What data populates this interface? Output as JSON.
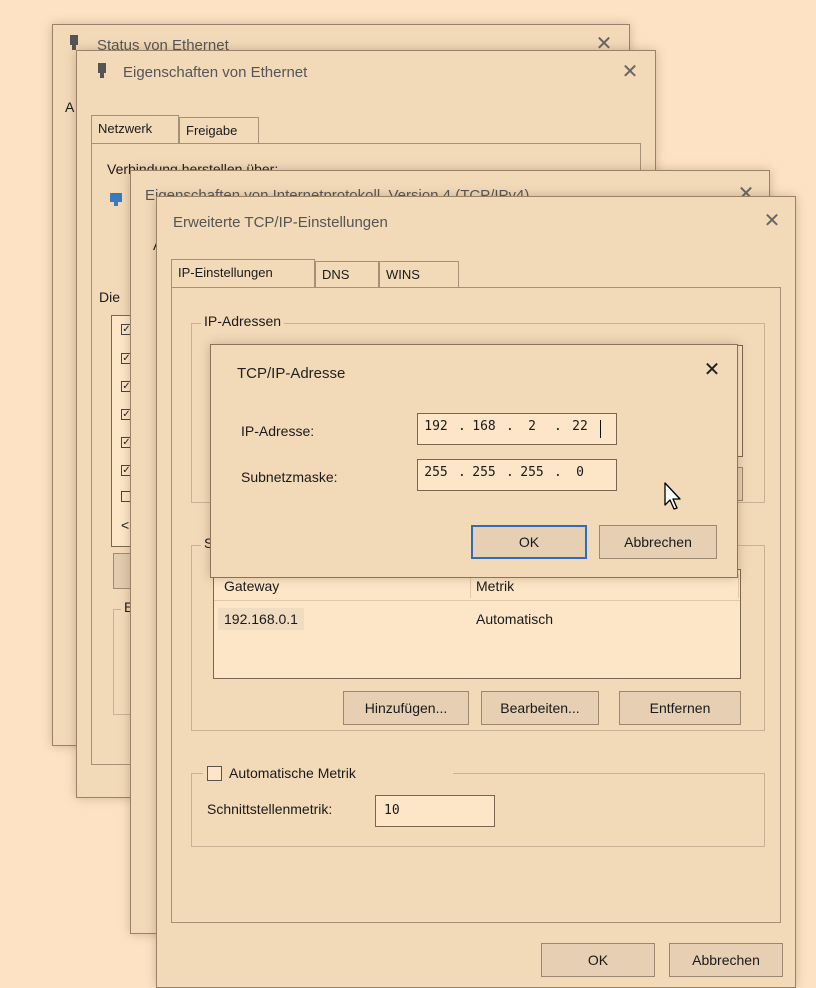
{
  "status_window": {
    "title": "Status von Ethernet",
    "partial_label": "A"
  },
  "ethernet_props_window": {
    "title": "Eigenschaften von Ethernet",
    "tabs": [
      "Netzwerk",
      "Freigabe"
    ],
    "connect_label": "Verbindung herstellen über:",
    "components_label": "Die",
    "scroll_left": "<",
    "partial_group_label": "E"
  },
  "ipv4_window": {
    "title": "Eigenschaften von Internetprotokoll, Version 4 (TCP/IPv4)",
    "partial_label": "A"
  },
  "advanced_window": {
    "title": "Erweiterte TCP/IP-Einstellungen",
    "tabs": [
      "IP-Einstellungen",
      "DNS",
      "WINS"
    ],
    "ip_group_label": "IP-Adressen",
    "gateway_group_label": "Sta",
    "gateway_table": {
      "headers": [
        "Gateway",
        "Metrik"
      ],
      "rows": [
        [
          "192.168.0.1",
          "Automatisch"
        ]
      ]
    },
    "buttons": {
      "add": "Hinzufügen...",
      "edit": "Bearbeiten...",
      "remove": "Entfernen"
    },
    "auto_metric_label": "Automatische Metrik",
    "auto_metric_checked": false,
    "interface_metric_label": "Schnittstellenmetrik:",
    "interface_metric_value": "10",
    "ok": "OK",
    "cancel": "Abbrechen"
  },
  "tcpip_dialog": {
    "title": "TCP/IP-Adresse",
    "ip_label": "IP-Adresse:",
    "ip_octets": [
      "192",
      "168",
      "2",
      "22"
    ],
    "mask_label": "Subnetzmaske:",
    "mask_octets": [
      "255",
      "255",
      "255",
      "0"
    ],
    "ok": "OK",
    "cancel": "Abbrechen"
  },
  "icons": {
    "close": "close-icon",
    "network": "network-adapter-icon",
    "cursor": "mouse-pointer-icon"
  },
  "colors": {
    "background": "#fde3c4",
    "window": "#f2d9b8",
    "accent": "#2a6fbf"
  }
}
